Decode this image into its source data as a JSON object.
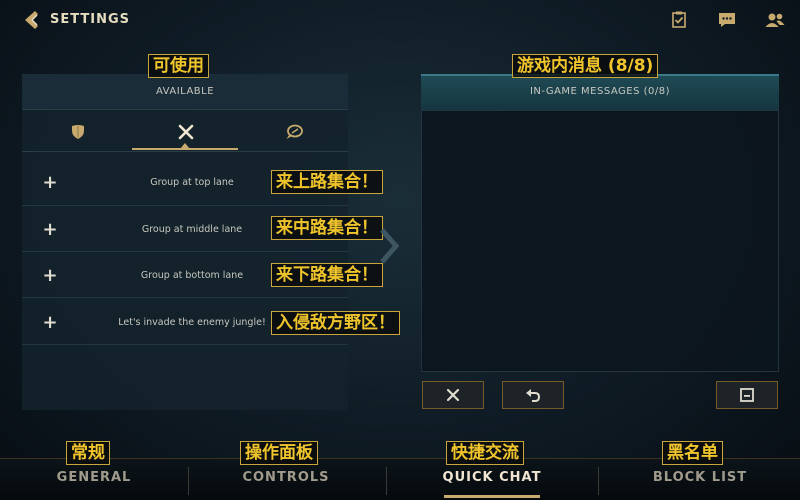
{
  "header": {
    "title": "SETTINGS",
    "icons": [
      "missions-icon",
      "chat-icon",
      "friends-icon"
    ]
  },
  "available": {
    "title": "AVAILABLE",
    "title_cn": "可使用",
    "tabs": [
      "shield-icon",
      "crossed-swords-icon",
      "chat-bubble-icon"
    ],
    "items": [
      {
        "text": "Group at top lane",
        "cn": "来上路集合！"
      },
      {
        "text": "Group at middle lane",
        "cn": "来中路集合！"
      },
      {
        "text": "Group at bottom lane",
        "cn": "来下路集合！"
      },
      {
        "text": "Let's invade the enemy jungle!",
        "cn": "入侵敌方野区！"
      }
    ]
  },
  "messages": {
    "title": "IN-GAME MESSAGES (0/8)",
    "title_cn": "游戏内消息 (8/8)",
    "buttons": [
      "close-icon",
      "undo-icon",
      "save-icon"
    ]
  },
  "nav": {
    "tabs": [
      {
        "label": "GENERAL",
        "cn": "常规"
      },
      {
        "label": "CONTROLS",
        "cn": "操作面板"
      },
      {
        "label": "QUICK CHAT",
        "cn": "快捷交流"
      },
      {
        "label": "BLOCK LIST",
        "cn": "黑名单"
      }
    ],
    "active_index": 2
  },
  "colors": {
    "gold": "#c8aa6e",
    "annotation": "#f0c52c",
    "panel": "#13222b",
    "teal_header": "#1f4a55"
  }
}
